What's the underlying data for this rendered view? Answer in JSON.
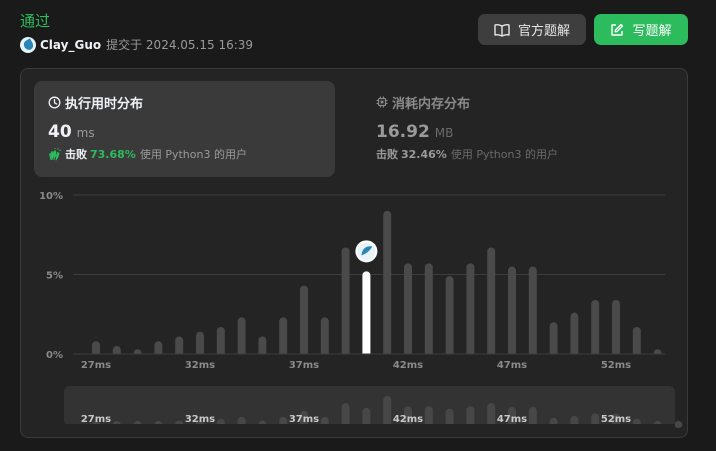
{
  "header": {
    "status": "通过",
    "username": "Clay_Guo",
    "submitted_text": "提交于 2024.05.15 16:39",
    "official_solution_label": "官方题解",
    "write_solution_label": "写题解"
  },
  "runtime_card": {
    "title": "执行用时分布",
    "value": "40",
    "unit": "ms",
    "beats_word": "击败",
    "beats_pct": "73.68%",
    "beats_text": "使用 Python3 的用户"
  },
  "memory_card": {
    "title": "消耗内存分布",
    "value": "16.92",
    "unit": "MB",
    "beats_word": "击败",
    "beats_pct": "32.46%",
    "beats_text": "使用 Python3 的用户"
  },
  "colors": {
    "accent": "#2cbb5d",
    "bar": "#4a4a4a",
    "highlight_bar": "#ffffff"
  },
  "chart_data": {
    "type": "bar",
    "title": "执行用时分布",
    "xlabel": "",
    "ylabel": "",
    "x": [
      26,
      27,
      28,
      29,
      30,
      31,
      32,
      33,
      34,
      35,
      36,
      37,
      38,
      39,
      40,
      41,
      42,
      43,
      44,
      45,
      46,
      47,
      48,
      49,
      50,
      51,
      52,
      53,
      54
    ],
    "values": [
      0.8,
      0.5,
      0.3,
      0.8,
      1.1,
      1.4,
      1.7,
      2.3,
      1.1,
      2.3,
      4.3,
      2.3,
      6.7,
      5.2,
      9.0,
      5.7,
      5.7,
      4.9,
      5.7,
      6.7,
      5.5,
      5.5,
      2.0,
      2.6,
      3.4,
      3.4,
      1.7,
      0.3,
      0.0
    ],
    "highlight_x": 39,
    "ylim": [
      0,
      10
    ],
    "ytick_labels": [
      "10%",
      "5%",
      "0%"
    ],
    "ytick_values": [
      10,
      5,
      0
    ],
    "xtick_labels": [
      "27ms",
      "32ms",
      "37ms",
      "42ms",
      "47ms",
      "52ms"
    ],
    "xtick_values": [
      26,
      31,
      36,
      41,
      46,
      51
    ],
    "grid": true,
    "legend": "none"
  }
}
